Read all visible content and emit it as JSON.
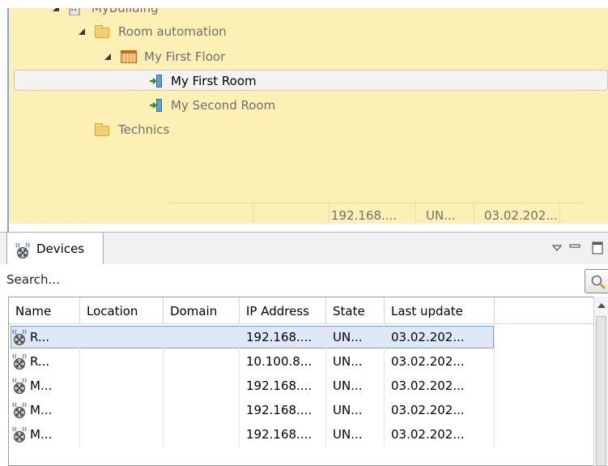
{
  "tree": {
    "items": [
      {
        "label": "MyBuilding",
        "icon": "building-icon",
        "expanded": true
      },
      {
        "label": "Room automation",
        "icon": "folder-icon",
        "expanded": true
      },
      {
        "label": "My First Floor",
        "icon": "floor-icon",
        "expanded": true
      },
      {
        "label": "My First Room",
        "icon": "room-icon",
        "selected": true
      },
      {
        "label": "My Second Room",
        "icon": "room-icon"
      },
      {
        "label": "Technics",
        "icon": "folder-icon"
      }
    ],
    "column_values": [
      "",
      "",
      "192.168....",
      "UN...",
      "03.02.202..."
    ],
    "background": "#fcf0b4"
  },
  "devices_view": {
    "tab_label": "Devices",
    "tab_icon": "device-router-icon",
    "toolbar_icons": [
      "view-menu-icon",
      "minimize-icon",
      "maximize-icon"
    ],
    "search": {
      "placeholder": "Search...",
      "value": "",
      "button_icon": "magnifier-icon"
    },
    "table": {
      "columns": [
        "Name",
        "Location",
        "Domain",
        "IP Address",
        "State",
        "Last update"
      ],
      "rows": [
        {
          "name": "R...",
          "location": "",
          "domain": "",
          "ip": "192.168....",
          "state": "UN...",
          "last_update": "03.02.202...",
          "selected": true
        },
        {
          "name": "R...",
          "location": "",
          "domain": "",
          "ip": "10.100.8...",
          "state": "UN...",
          "last_update": "03.02.202..."
        },
        {
          "name": "M...",
          "location": "",
          "domain": "",
          "ip": "192.168....",
          "state": "UN...",
          "last_update": "03.02.202..."
        },
        {
          "name": "M...",
          "location": "",
          "domain": "",
          "ip": "192.168....",
          "state": "UN...",
          "last_update": "03.02.202..."
        },
        {
          "name": "M...",
          "location": "",
          "domain": "",
          "ip": "192.168....",
          "state": "UN...",
          "last_update": "03.02.202..."
        }
      ]
    },
    "selection_color": "#dde9f9"
  }
}
